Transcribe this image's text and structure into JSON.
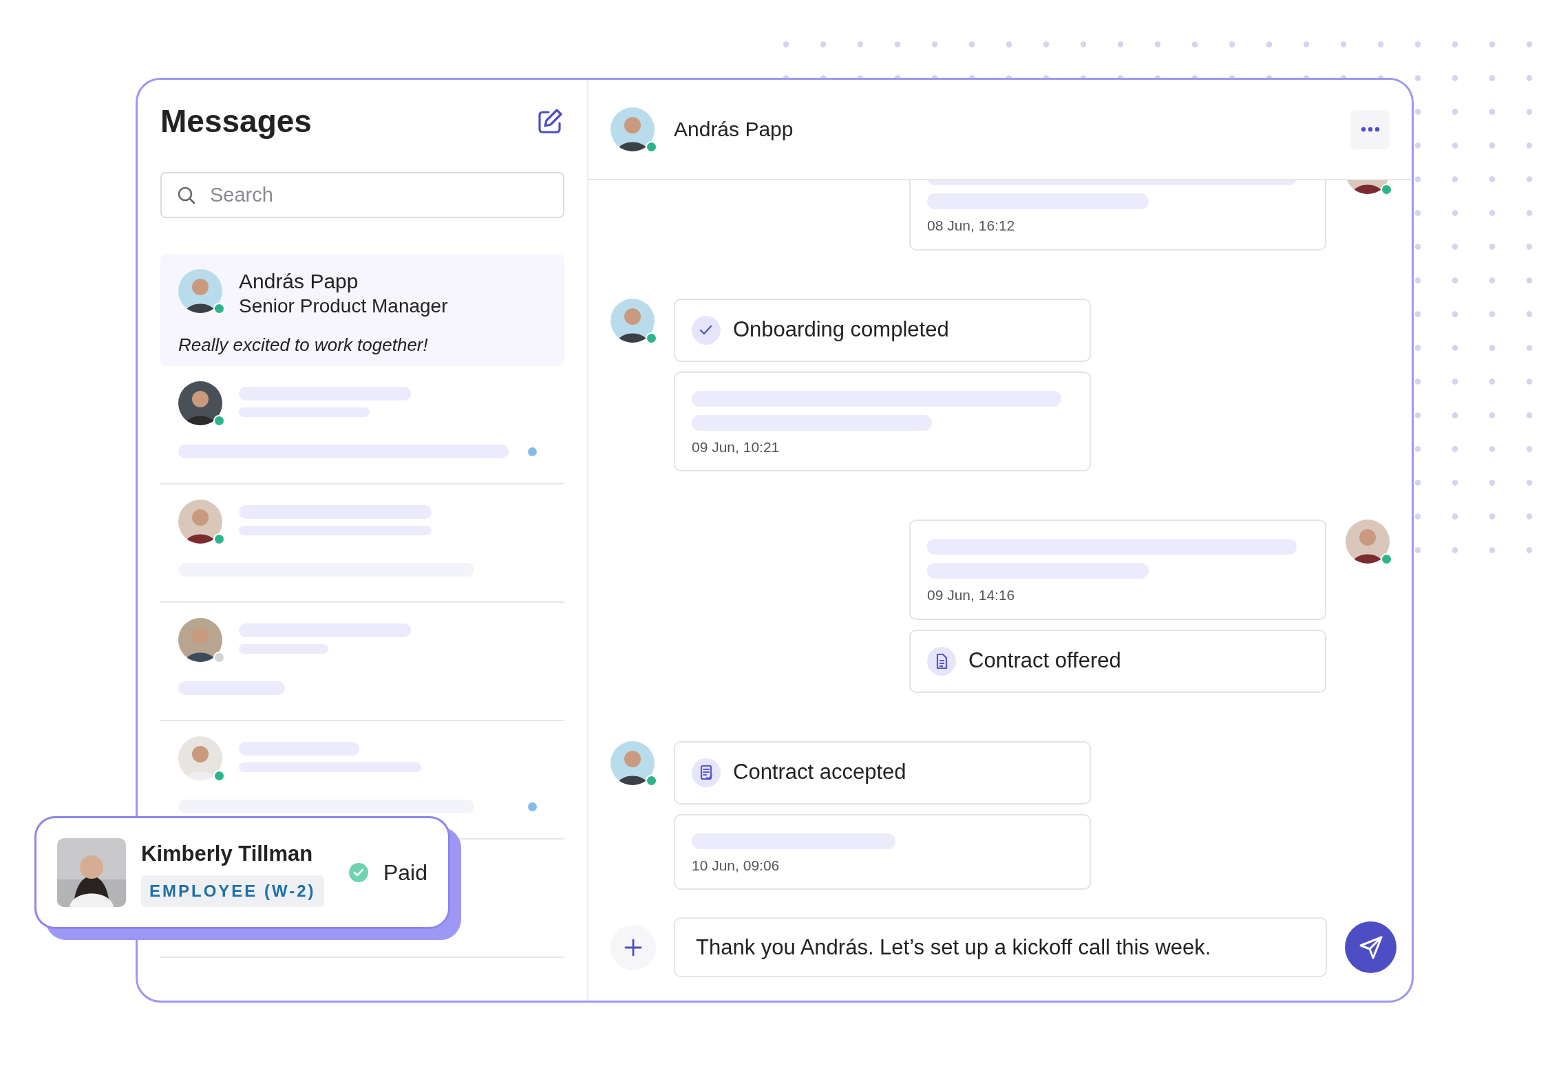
{
  "sidebar": {
    "title": "Messages",
    "search": {
      "placeholder": "Search"
    },
    "conversations": [
      {
        "kind": "full",
        "name": "András Papp",
        "subtitle": "Senior Product Manager",
        "preview": "Really excited to work together!",
        "selected": true,
        "online": true,
        "unread": false
      },
      {
        "kind": "skeleton",
        "selected": false,
        "online": true,
        "unread": true
      },
      {
        "kind": "skeleton",
        "selected": false,
        "online": true,
        "unread": false
      },
      {
        "kind": "skeleton",
        "selected": false,
        "online": false,
        "unread": false
      },
      {
        "kind": "skeleton",
        "selected": false,
        "online": true,
        "unread": true
      }
    ]
  },
  "chat": {
    "header": {
      "name": "András Papp",
      "online": true
    },
    "groups": [
      {
        "outgoing": true,
        "online": true,
        "messages": [
          {
            "kind": "text",
            "timestamp": "08 Jun, 16:12"
          }
        ]
      },
      {
        "outgoing": false,
        "online": true,
        "messages": [
          {
            "kind": "event",
            "label": "Onboarding completed"
          },
          {
            "kind": "text",
            "timestamp": "09 Jun, 10:21"
          }
        ]
      },
      {
        "outgoing": true,
        "online": true,
        "messages": [
          {
            "kind": "text",
            "timestamp": "09 Jun, 14:16"
          },
          {
            "kind": "event",
            "label": "Contract offered"
          }
        ]
      },
      {
        "outgoing": false,
        "online": true,
        "messages": [
          {
            "kind": "event",
            "label": "Contract accepted"
          },
          {
            "kind": "text",
            "timestamp": "10 Jun, 09:06"
          }
        ]
      }
    ],
    "composer": {
      "value": "Thank you András. Let’s set up a kickoff call this week."
    }
  },
  "profile_card": {
    "name": "Kimberly Tillman",
    "tag": "EMPLOYEE (W-2)",
    "status": "Paid"
  }
}
